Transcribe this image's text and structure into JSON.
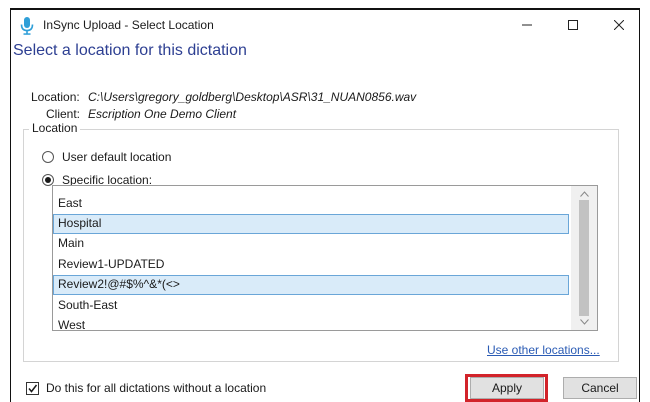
{
  "window": {
    "title": "InSync Upload - Select Location",
    "controls": {
      "minimize": "—",
      "maximize": "☐",
      "close": "✕"
    }
  },
  "heading": "Select a location for this dictation",
  "info": {
    "location_label": "Location:",
    "location_value": "C:\\Users\\gregory_goldberg\\Desktop\\ASR\\31_NUAN0856.wav",
    "client_label": "Client:",
    "client_value": "Escription One Demo Client"
  },
  "location_group": {
    "legend": "Location",
    "options": [
      {
        "label": "User default location",
        "selected": false
      },
      {
        "label": "Specific location:",
        "selected": true
      }
    ],
    "list_items": [
      {
        "label": "East",
        "selected": false
      },
      {
        "label": "Hospital",
        "selected": true
      },
      {
        "label": "Main",
        "selected": false
      },
      {
        "label": "Review1-UPDATED",
        "selected": false
      },
      {
        "label": "Review2!@#$%^&*(<>",
        "selected": true
      },
      {
        "label": "South-East",
        "selected": false
      },
      {
        "label": "West",
        "selected": false
      }
    ],
    "use_other_link": "Use other locations..."
  },
  "footer": {
    "checkbox_label": "Do this for all dictations without a location",
    "checkbox_checked": true,
    "apply_label": "Apply",
    "cancel_label": "Cancel"
  },
  "colors": {
    "heading": "#2d3f92",
    "selection": "#d9ebf9",
    "selection_border": "#6aa6d8",
    "link": "#2a5bb4",
    "highlight": "#d2232a"
  },
  "icons": {
    "app": "microphone-icon",
    "minimize": "minimize-icon",
    "maximize": "maximize-icon",
    "close": "close-icon"
  }
}
